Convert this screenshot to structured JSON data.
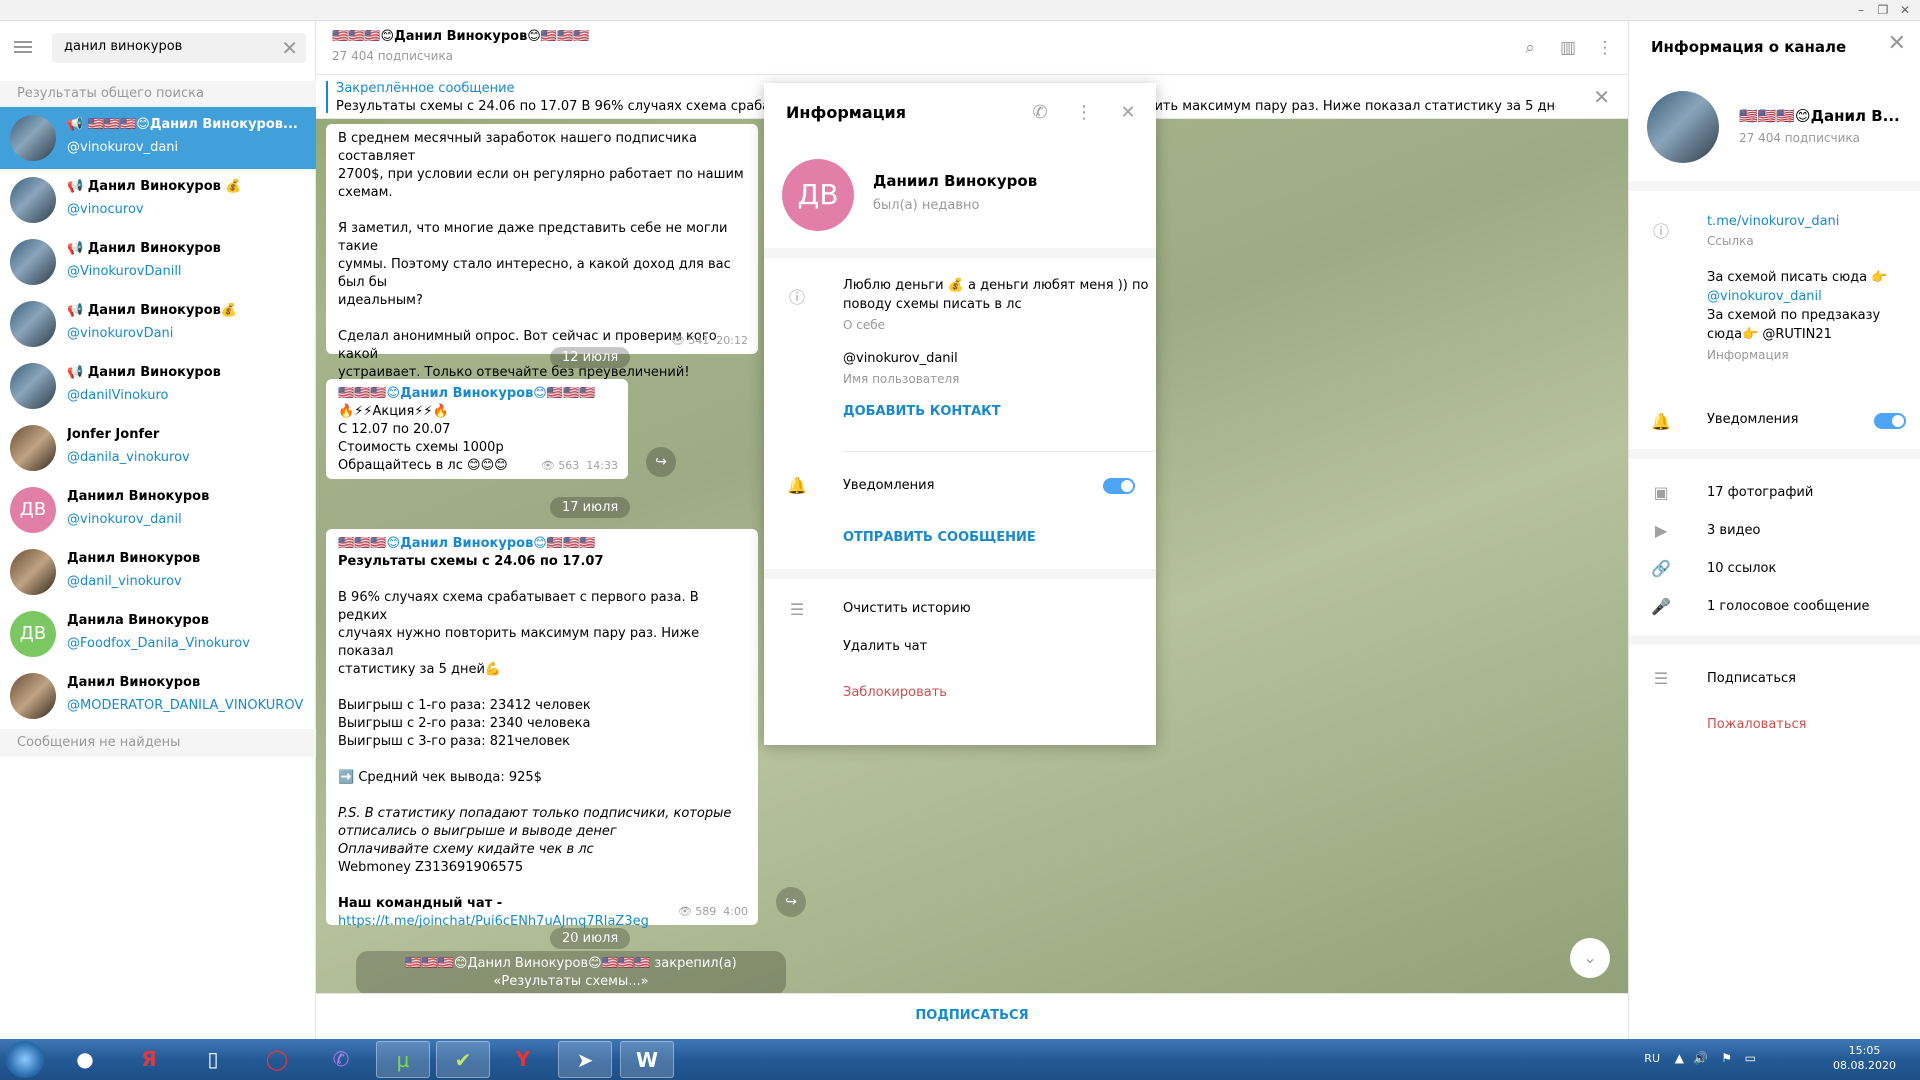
{
  "window": {
    "minimize": "–",
    "maximize": "❐",
    "close": "✕"
  },
  "search": {
    "value": "данил винокуров",
    "clear_icon": "✕"
  },
  "results_header": "Результаты общего поиска",
  "results": [
    {
      "name": "📢 🇺🇸🇺🇸🇺🇸😊Данил Винокуров...",
      "username": "@vinokurov_dani",
      "avatar": "photo",
      "active": true
    },
    {
      "name": "📢 Данил Винокуров 💰",
      "username": "@vinocurov",
      "avatar": "photo"
    },
    {
      "name": "📢 Данил Винокуров",
      "username": "@VinokurovDanill",
      "avatar": "photo"
    },
    {
      "name": "📢 Данил Винокуров💰",
      "username": "@vinokurovDani",
      "avatar": "photo"
    },
    {
      "name": "📢 Данил Винокуров",
      "username": "@danilVinokuro",
      "avatar": "photo"
    },
    {
      "name": "Jonfer Jonfer",
      "username": "@danila_vinokurov",
      "avatar": "photo2"
    },
    {
      "name": "Даниил Винокуров",
      "username": "@vinokurov_danil",
      "avatar": "initials",
      "initials": "ДВ",
      "color": "#e17fa8"
    },
    {
      "name": "Данил Винокуров",
      "username": "@danil_vinokurov",
      "avatar": "photo2"
    },
    {
      "name": "Данила Винокуров",
      "username": "@Foodfox_Danila_Vinokurov",
      "avatar": "initials",
      "initials": "ДВ",
      "color": "#7bc862"
    },
    {
      "name": "Данил Винокуров",
      "username": "@MODERATOR_DANILA_VINOKUROV",
      "avatar": "photo2"
    }
  ],
  "no_results": "Сообщения не найдены",
  "chat": {
    "title": "🇺🇸🇺🇸🇺🇸😊Данил Винокуров😊🇺🇸🇺🇸🇺🇸",
    "subscribers": "27 404 подписчика",
    "pinned_title": "Закреплённое сообщение",
    "pinned_text": "Результаты схемы с 24.06  по 17.07  В 96% случаях схема срабатывает с первого раза. В редких случаях нужно повторить максимум пару раз. Ниже показал статистику за 5 дней💪",
    "msg1": {
      "lines": [
        "В среднем месячный заработок нашего подписчика составляет",
        "2700$, при условии если он регулярно работает по нашим",
        "схемам.",
        "",
        "Я заметил, что многие даже представить себе не могли такие",
        "суммы. Поэтому стало интересно, а какой доход для вас был бы",
        "идеальным?",
        "",
        "Сделал анонимный опрос. Вот сейчас и проверим кого какой",
        "устраивает. Только отвечайте без преувеличений!"
      ],
      "views": "👁 541",
      "time": "20:12"
    },
    "date1": "12 июля",
    "msg2": {
      "author": "🇺🇸🇺🇸🇺🇸😊Данил Винокуров😊🇺🇸🇺🇸🇺🇸",
      "lines": [
        "🔥⚡⚡Акция⚡⚡🔥",
        "С 12.07 по 20.07",
        "Стоимость схемы 1000р",
        "Обращайтесь в лс 😊😊😊"
      ],
      "views": "👁 563",
      "time": "14:33"
    },
    "date2": "17 июля",
    "msg3": {
      "author": "🇺🇸🇺🇸🇺🇸😊Данил Винокуров😊🇺🇸🇺🇸🇺🇸",
      "lines": [
        "Результаты схемы с 24.06  по 17.07",
        "",
        "В 96% случаях схема срабатывает с первого раза. В редких",
        "случаях нужно повторить максимум пару раз. Ниже показал",
        "статистику за 5 дней💪",
        "",
        "Выигрыш с 1-го раза: 23412 человек",
        "Выигрыш с 2-го раза: 2340 человека",
        "Выигрыш с 3-го раза: 821человек",
        "",
        "➡️ Средний чек вывода: 925$",
        "",
        "P.S. В статистику попадают только подписчики, которые",
        "отписались о выигрыше и выводе денег",
        "Оплачивайте схему кидайте чек в лс",
        "Webmoney Z313691906575",
        "",
        "Наш командный чат -"
      ],
      "link": "https://t.me/joinchat/Pui6cENh7uAJmq7RIaZ3eg",
      "views": "👁 589",
      "time": "4:00"
    },
    "date3": "20 июля",
    "service": "🇺🇸🇺🇸🇺🇸😊Данил Винокуров😊🇺🇸🇺🇸🇺🇸 закрепил(а) «Результаты схемы...»",
    "subscribe": "ПОДПИСАТЬСЯ",
    "scroll_icon": "⌄",
    "share_icon": "↪"
  },
  "right": {
    "title": "Информация о канале",
    "close_icon": "✕",
    "name": "🇺🇸🇺🇸🇺🇸😊Данил В...",
    "subs": "27 404 подписчика",
    "link": "t.me/vinokurov_dani",
    "link_label": "Ссылка",
    "info_lines": [
      "За схемой писать сюда 👉",
      "@vinokurov_danil",
      "За схемой по предзаказу",
      "сюда👉 @RUTIN21"
    ],
    "info_label": "Информация",
    "notifications": "Уведомления",
    "photos": "17 фотографий",
    "videos": "3 видео",
    "links": "10 ссылок",
    "voice": "1 голосовое сообщение",
    "subscribe": "Подписаться",
    "report": "Пожаловаться"
  },
  "modal": {
    "title": "Информация",
    "call_icon": "📞",
    "more_icon": "⋮",
    "close_icon": "✕",
    "initials": "ДВ",
    "name": "Даниил Винокуров",
    "status": "был(а) недавно",
    "bio_lines": [
      "Люблю деньги 💰 а деньги любят меня )) по",
      "поводу схемы писать в лс"
    ],
    "bio_label": "О себе",
    "username": "@vinokurov_danil",
    "username_label": "Имя пользователя",
    "add_contact": "ДОБАВИТЬ КОНТАКТ",
    "notifications": "Уведомления",
    "send_message": "ОТПРАВИТЬ СООБЩЕНИЕ",
    "clear_history": "Очистить историю",
    "delete_chat": "Удалить чат",
    "block": "Заблокировать"
  },
  "taskbar": {
    "lang": "RU",
    "time": "15:05",
    "date": "08.08.2020"
  },
  "colors": {
    "accent": "#168acd",
    "active": "#419fd9",
    "danger": "#d14e4e",
    "pink_avatar": "#e17fa8",
    "green_avatar": "#7bc862"
  }
}
